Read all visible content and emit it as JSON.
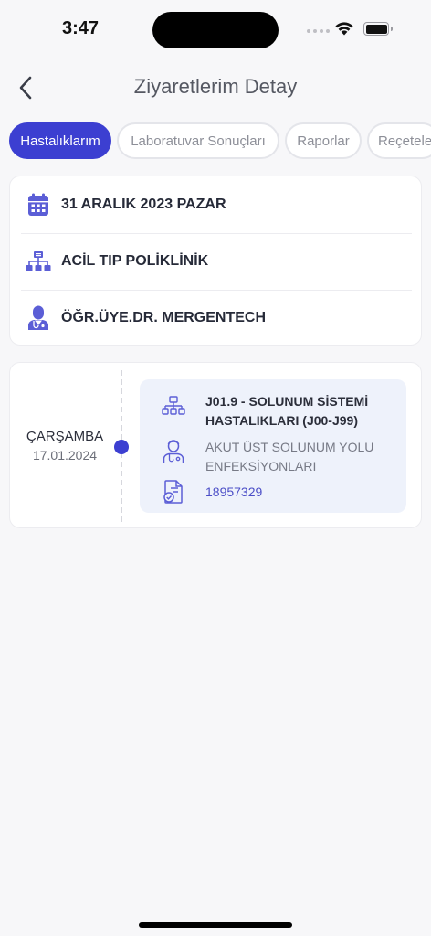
{
  "status_bar": {
    "time": "3:47"
  },
  "header": {
    "title": "Ziyaretlerim Detay"
  },
  "tabs": [
    {
      "label": "Hastalıklarım",
      "active": true
    },
    {
      "label": "Laboratuvar Sonuçları",
      "active": false
    },
    {
      "label": "Raporlar",
      "active": false
    },
    {
      "label": "Reçeteler",
      "active": false
    }
  ],
  "info": {
    "date": "31 ARALIK 2023 PAZAR",
    "clinic": "ACİL TIP POLİKLİNİK",
    "doctor": "ÖĞR.ÜYE.DR. MERGENTECH"
  },
  "visit": {
    "day_name": "ÇARŞAMBA",
    "date": "17.01.2024",
    "diagnosis_code": "J01.9 - SOLUNUM SİSTEMİ HASTALIKLARI (J00-J99)",
    "diagnosis_name": "AKUT ÜST SOLUNUM YOLU ENFEKSİYONLARI",
    "protocol_no": "18957329"
  },
  "colors": {
    "accent": "#3c3fd1",
    "icon": "#5b5ed6",
    "detail_bg": "#eef2fb"
  },
  "icons": {
    "back": "chevron-left-icon",
    "date": "calendar-icon",
    "clinic": "hierarchy-icon",
    "doctor": "doctor-icon",
    "diagnosis_code": "hierarchy-icon",
    "diagnosis_name": "doctor-outline-icon",
    "protocol": "document-check-icon"
  }
}
